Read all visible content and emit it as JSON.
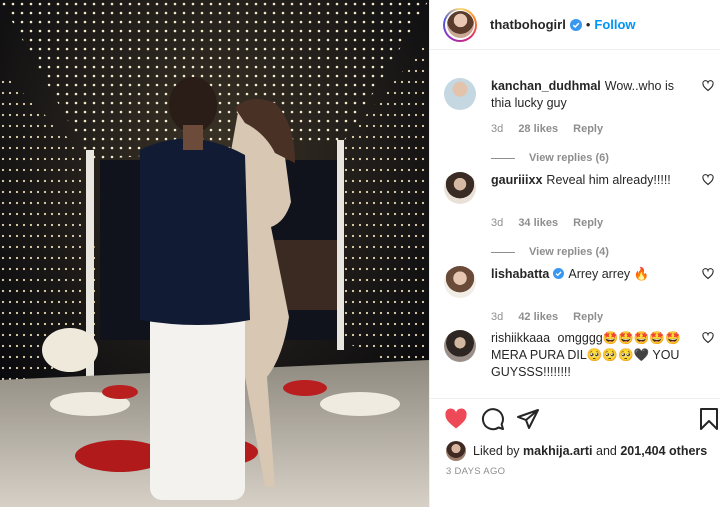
{
  "post": {
    "username": "thatbohogirl",
    "follow_label": "Follow",
    "dot": "•"
  },
  "comments": [
    {
      "user": "kanchan_dudhmal",
      "text": "Wow..who is thia lucky guy",
      "age": "3d",
      "likes": "28 likes",
      "reply": "Reply",
      "view_replies": "View replies (6)",
      "verified": false
    },
    {
      "user": "gauriiixx",
      "text": "Reveal him already!!!!!",
      "age": "3d",
      "likes": "34 likes",
      "reply": "Reply",
      "view_replies": "View replies (4)",
      "verified": false
    },
    {
      "user": "lishabatta",
      "text": "Arrey arrey 🔥",
      "age": "3d",
      "likes": "42 likes",
      "reply": "Reply",
      "verified": true
    },
    {
      "user": "rishiikkaaa",
      "text": "omgggg🤩🤩🤩🤩🤩MERA PURA DIL🥺🥺🥺🖤 YOU GUYSSS!!!!!!!!",
      "verified": false
    }
  ],
  "footer": {
    "liked_by_prefix": "Liked by",
    "liked_by_user": "makhija.arti",
    "and": "and",
    "others_count": "201,404 others",
    "timestamp": "3 DAYS AGO"
  },
  "icons": {
    "like": "heart-filled-icon",
    "comment": "comment-bubble-icon",
    "share": "paper-plane-icon",
    "save": "bookmark-icon"
  },
  "colors": {
    "accent": "#0095f6",
    "heart": "#ed4956",
    "muted": "#8e8e8e"
  }
}
